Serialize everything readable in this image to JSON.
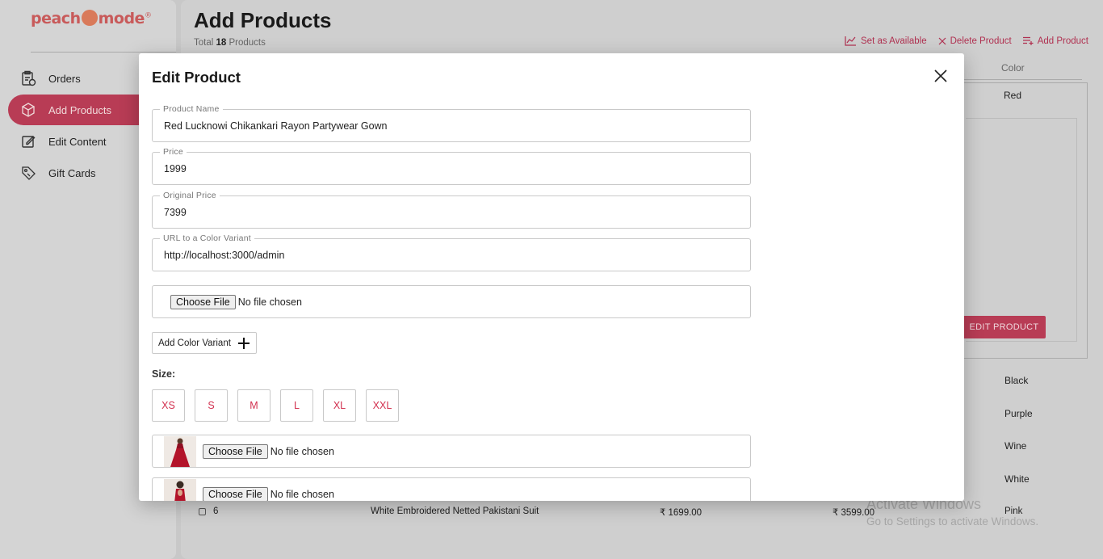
{
  "sidebar": {
    "logo": {
      "part1": "peach",
      "part2": "mode",
      "registered": "®"
    },
    "items": [
      {
        "label": "Orders",
        "icon": "orders-icon"
      },
      {
        "label": "Add Products",
        "icon": "box-icon",
        "active": true
      },
      {
        "label": "Edit Content",
        "icon": "edit-icon"
      },
      {
        "label": "Gift Cards",
        "icon": "tag-icon"
      }
    ]
  },
  "page": {
    "title": "Add Products",
    "total_prefix": "Total",
    "total_count": "18",
    "total_suffix": "Products",
    "actions": {
      "set_available": "Set as Available",
      "delete_product": "Delete Product",
      "add_product": "Add Product"
    }
  },
  "background_table": {
    "color_header": "Color",
    "colors": [
      "Red",
      "Black",
      "Purple",
      "Wine",
      "White",
      "Pink"
    ],
    "edit_button": "EDIT PRODUCT",
    "visible_row": {
      "index": "6",
      "name": "White Embroidered Netted Pakistani Suit",
      "price": "₹ 1699.00",
      "original_price": "₹ 3599.00"
    }
  },
  "modal": {
    "title": "Edit Product",
    "fields": {
      "product_name": {
        "label": "Product Name",
        "value": "Red Lucknowi Chikankari Rayon Partywear Gown"
      },
      "price": {
        "label": "Price",
        "value": "1999"
      },
      "original_price": {
        "label": "Original Price",
        "value": "7399"
      },
      "color_variant_url": {
        "label": "URL to a Color Variant",
        "value": "http://localhost:3000/admin"
      }
    },
    "file_input": {
      "button": "Choose File",
      "status": "No file chosen"
    },
    "add_variant_label": "Add Color Variant",
    "size_label": "Size:",
    "sizes": [
      "XS",
      "S",
      "M",
      "L",
      "XL",
      "XXL"
    ],
    "images": [
      {
        "button": "Choose File",
        "status": "No file chosen"
      },
      {
        "button": "Choose File",
        "status": "No file chosen"
      }
    ]
  },
  "watermark": {
    "line1": "Activate Windows",
    "line2": "Go to Settings to activate Windows."
  },
  "colors": {
    "accent": "#d2304f",
    "accent_dim": "#b83c55",
    "overlay": "#c8c8c8"
  }
}
